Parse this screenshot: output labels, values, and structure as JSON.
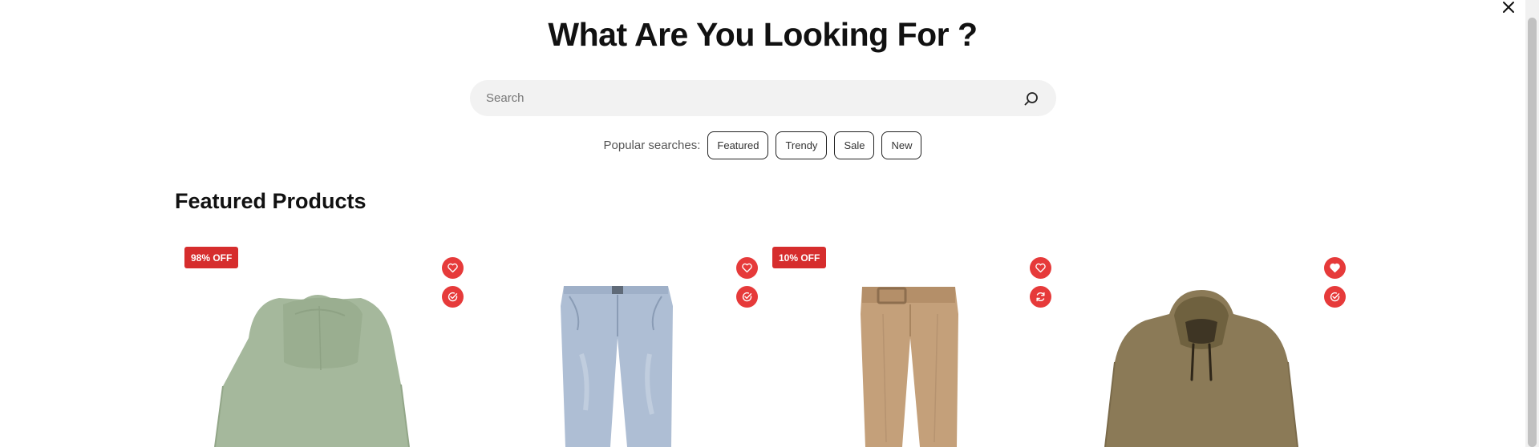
{
  "modal": {
    "title": "What Are You Looking For ?",
    "close_icon": "close-icon"
  },
  "search": {
    "placeholder": "Search",
    "value": "",
    "icon": "search-icon"
  },
  "popular": {
    "label": "Popular searches:",
    "tags": [
      "Featured",
      "Trendy",
      "Sale",
      "New"
    ]
  },
  "featured": {
    "title": "Featured Products",
    "products": [
      {
        "badge": "98% OFF",
        "item": "sage green hoodie",
        "wishlisted": false,
        "action_icon": "check-circle-icon"
      },
      {
        "badge": "",
        "item": "light blue denim jeans",
        "wishlisted": false,
        "action_icon": "check-circle-icon"
      },
      {
        "badge": "10% OFF",
        "item": "tan belted trousers",
        "wishlisted": false,
        "action_icon": "refresh-icon"
      },
      {
        "badge": "",
        "item": "olive brown hoodie",
        "wishlisted": true,
        "action_icon": "check-circle-icon"
      }
    ]
  },
  "colors": {
    "accent": "#e63a3a",
    "badge": "#d62d2d",
    "search_bg": "#f2f2f2"
  }
}
